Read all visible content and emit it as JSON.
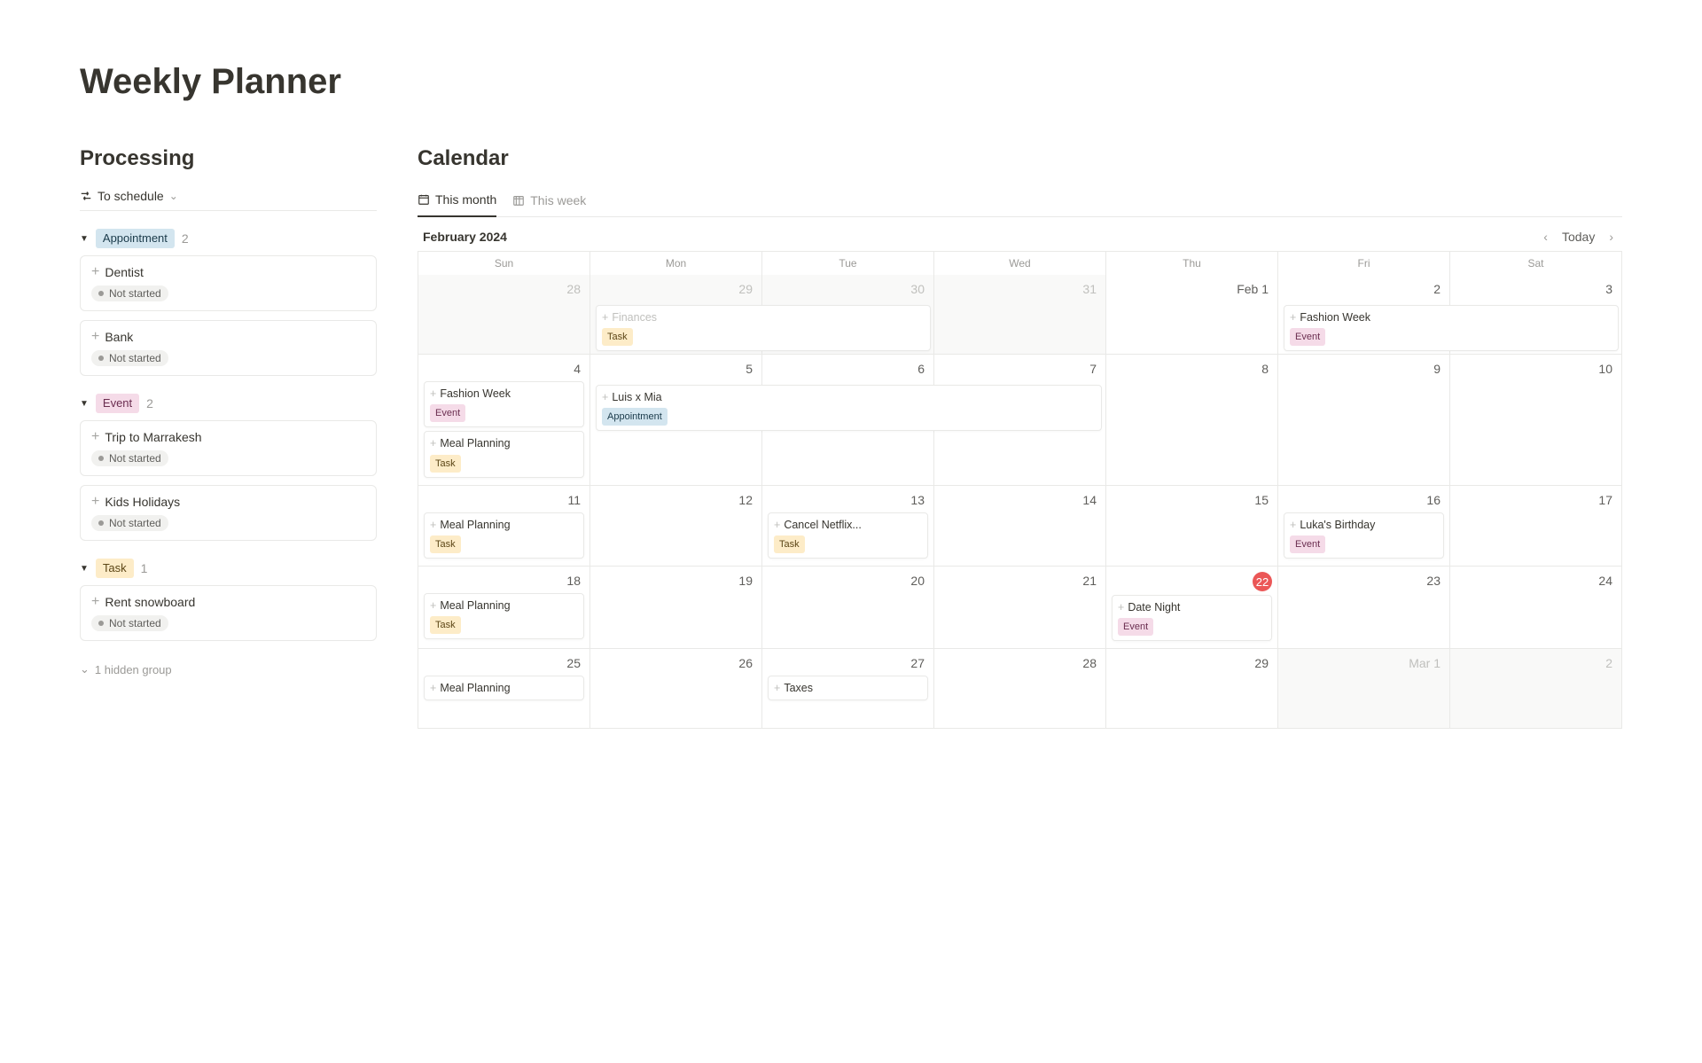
{
  "page_title": "Weekly Planner",
  "processing": {
    "title": "Processing",
    "view_label": "To schedule",
    "status_not_started": "Not started",
    "hidden_group": "1 hidden group",
    "groups": [
      {
        "key": "appointment",
        "label": "Appointment",
        "pill_class": "pill-appointment",
        "count": "2",
        "items": [
          {
            "title": "Dentist"
          },
          {
            "title": "Bank"
          }
        ]
      },
      {
        "key": "event",
        "label": "Event",
        "pill_class": "pill-event",
        "count": "2",
        "items": [
          {
            "title": "Trip to Marrakesh"
          },
          {
            "title": "Kids Holidays"
          }
        ]
      },
      {
        "key": "task",
        "label": "Task",
        "pill_class": "pill-task",
        "count": "1",
        "items": [
          {
            "title": "Rent snowboard"
          }
        ]
      }
    ]
  },
  "calendar": {
    "title": "Calendar",
    "tabs": {
      "month": "This month",
      "week": "This week"
    },
    "month_label": "February 2024",
    "today_label": "Today",
    "dow": [
      "Sun",
      "Mon",
      "Tue",
      "Wed",
      "Thu",
      "Fri",
      "Sat"
    ],
    "weeks": [
      [
        {
          "num": "28",
          "out": true
        },
        {
          "num": "29",
          "out": true,
          "events": [
            {
              "title": "Finances",
              "tag": "Task",
              "tag_class": "pill-task",
              "span": 2
            }
          ]
        },
        {
          "num": "30",
          "out": true
        },
        {
          "num": "31",
          "out": true
        },
        {
          "num": "Feb 1",
          "first": true
        },
        {
          "num": "2",
          "events": [
            {
              "title": "Fashion Week",
              "tag": "Event",
              "tag_class": "pill-event",
              "span": 2
            }
          ]
        },
        {
          "num": "3"
        }
      ],
      [
        {
          "num": "4",
          "events": [
            {
              "title": "Fashion Week",
              "tag": "Event",
              "tag_class": "pill-event"
            },
            {
              "title": "Meal Planning",
              "tag": "Task",
              "tag_class": "pill-task"
            }
          ]
        },
        {
          "num": "5",
          "events": [
            {
              "title": "Luis x Mia",
              "tag": "Appointment",
              "tag_class": "pill-appointment",
              "span": 3
            }
          ]
        },
        {
          "num": "6"
        },
        {
          "num": "7"
        },
        {
          "num": "8"
        },
        {
          "num": "9"
        },
        {
          "num": "10"
        }
      ],
      [
        {
          "num": "11",
          "events": [
            {
              "title": "Meal Planning",
              "tag": "Task",
              "tag_class": "pill-task"
            }
          ]
        },
        {
          "num": "12"
        },
        {
          "num": "13",
          "events": [
            {
              "title": "Cancel Netflix...",
              "tag": "Task",
              "tag_class": "pill-task"
            }
          ]
        },
        {
          "num": "14"
        },
        {
          "num": "15"
        },
        {
          "num": "16",
          "events": [
            {
              "title": "Luka's Birthday",
              "tag": "Event",
              "tag_class": "pill-event"
            }
          ]
        },
        {
          "num": "17"
        }
      ],
      [
        {
          "num": "18",
          "events": [
            {
              "title": "Meal Planning",
              "tag": "Task",
              "tag_class": "pill-task"
            }
          ]
        },
        {
          "num": "19"
        },
        {
          "num": "20"
        },
        {
          "num": "21"
        },
        {
          "num": "22",
          "today": true,
          "events": [
            {
              "title": "Date Night",
              "tag": "Event",
              "tag_class": "pill-event"
            }
          ]
        },
        {
          "num": "23"
        },
        {
          "num": "24"
        }
      ],
      [
        {
          "num": "25",
          "events": [
            {
              "title": "Meal Planning"
            }
          ]
        },
        {
          "num": "26"
        },
        {
          "num": "27",
          "events": [
            {
              "title": "Taxes"
            }
          ]
        },
        {
          "num": "28"
        },
        {
          "num": "29"
        },
        {
          "num": "Mar 1",
          "out": true,
          "first": true
        },
        {
          "num": "2",
          "out": true
        }
      ]
    ]
  }
}
